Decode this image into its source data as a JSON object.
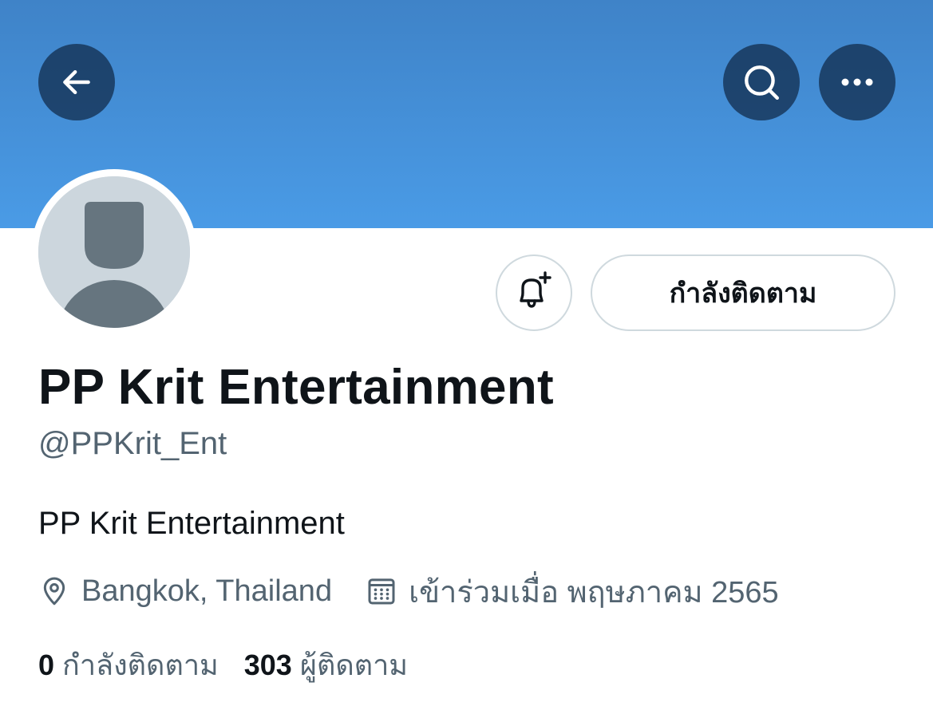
{
  "header": {
    "banner_color": "#4a9be6",
    "back_icon": "arrow-left-icon",
    "search_icon": "search-icon",
    "more_icon": "more-horizontal-icon"
  },
  "profile": {
    "avatar_icon": "default-avatar-icon",
    "display_name": "PP Krit Entertainment",
    "handle": "@PPKrit_Ent",
    "bio": "PP Krit Entertainment",
    "location": "Bangkok, Thailand",
    "joined": "เข้าร่วมเมื่อ พฤษภาคม 2565"
  },
  "actions": {
    "notify_icon": "bell-plus-icon",
    "follow_label": "กำลังติดตาม"
  },
  "stats": {
    "following_count": "0",
    "following_label": "กำลังติดตาม",
    "followers_count": "303",
    "followers_label": "ผู้ติดตาม"
  }
}
